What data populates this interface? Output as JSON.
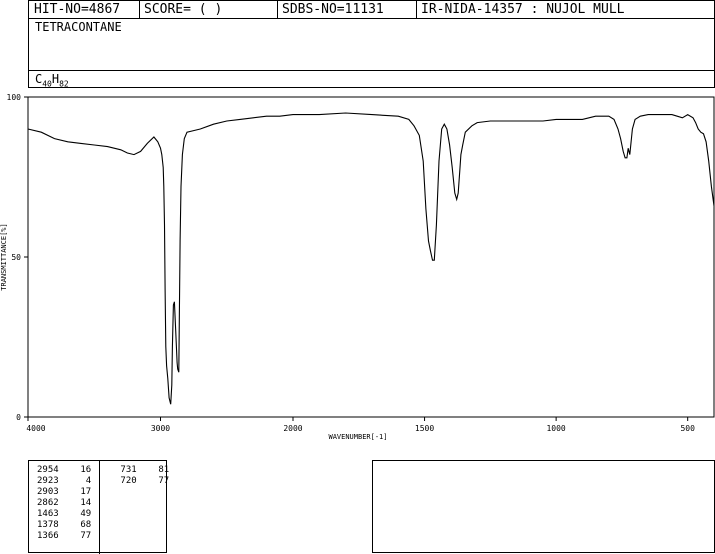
{
  "header": {
    "hit_no": "HIT-NO=4867",
    "score": "SCORE=  (   )",
    "sdbs_no": "SDBS-NO=11131",
    "ir_id": "IR-NIDA-14357 : NUJOL MULL"
  },
  "compound": {
    "name": "TETRACONTANE",
    "formula_c": "C",
    "formula_c_count": "40",
    "formula_h": "H",
    "formula_h_count": "82"
  },
  "chart_data": {
    "type": "line",
    "xlabel": "WAVENUMBER[-1]",
    "ylabel": "TRANSMITTANCE[%]",
    "xlim": [
      4000,
      400
    ],
    "ylim": [
      0,
      100
    ],
    "x_ticks": [
      "4000",
      "3000",
      "2000",
      "1500",
      "1000",
      "500"
    ],
    "x_tick_values": [
      4000,
      3000,
      2000,
      1500,
      1000,
      500
    ],
    "y_ticks": [
      "0",
      "50",
      "100"
    ],
    "y_tick_values": [
      0,
      50,
      100
    ],
    "series": [
      {
        "x": [
          4000,
          3900,
          3800,
          3700,
          3600,
          3500,
          3400,
          3300,
          3250,
          3200,
          3150,
          3100,
          3050,
          3020,
          3000,
          2990,
          2980,
          2975,
          2970,
          2965,
          2960,
          2954,
          2945,
          2935,
          2923,
          2915,
          2910,
          2903,
          2895,
          2885,
          2875,
          2870,
          2862,
          2858,
          2852,
          2845,
          2835,
          2820,
          2800,
          2750,
          2700,
          2600,
          2500,
          2400,
          2300,
          2200,
          2100,
          2000,
          1900,
          1800,
          1700,
          1600,
          1560,
          1540,
          1520,
          1505,
          1495,
          1485,
          1478,
          1470,
          1463,
          1455,
          1445,
          1435,
          1425,
          1415,
          1405,
          1395,
          1385,
          1378,
          1372,
          1366,
          1362,
          1355,
          1345,
          1320,
          1300,
          1250,
          1200,
          1150,
          1100,
          1050,
          1000,
          950,
          900,
          850,
          800,
          780,
          765,
          755,
          745,
          738,
          731,
          726,
          720,
          715,
          710,
          700,
          680,
          650,
          600,
          560,
          540,
          520,
          500,
          480,
          470,
          460,
          450,
          440,
          430,
          420,
          410,
          400
        ],
        "y": [
          90,
          89,
          87,
          86,
          85.5,
          85,
          84.5,
          83.5,
          82.5,
          82,
          83,
          85.5,
          87.5,
          86,
          84,
          82,
          78,
          72,
          60,
          40,
          22,
          16,
          12,
          6,
          4,
          10,
          22,
          35,
          36,
          27,
          17,
          15,
          14,
          30,
          55,
          72,
          82,
          87,
          89,
          89.5,
          90,
          91.5,
          92.5,
          93,
          93.5,
          94,
          94,
          94.5,
          94.5,
          95,
          94.5,
          94,
          93,
          91,
          88,
          80,
          65,
          55,
          52,
          49,
          49,
          60,
          80,
          90,
          91.5,
          90,
          85,
          78,
          70,
          68,
          70,
          77,
          82,
          85,
          89,
          91,
          92,
          92.5,
          92.5,
          92.5,
          92.5,
          92.5,
          93,
          93,
          93,
          94,
          94,
          93,
          90,
          87,
          83,
          81,
          81,
          84,
          82,
          86,
          90,
          93,
          94,
          94.5,
          94.5,
          94.5,
          94,
          93.5,
          94.5,
          93.5,
          92,
          90,
          89,
          88.5,
          86,
          80,
          72,
          66
        ]
      }
    ]
  },
  "peaks": {
    "col1": [
      [
        "2954",
        "16"
      ],
      [
        "2923",
        "4"
      ],
      [
        "2903",
        "17"
      ],
      [
        "2862",
        "14"
      ],
      [
        "1463",
        "49"
      ],
      [
        "1378",
        "68"
      ],
      [
        "1366",
        "77"
      ]
    ],
    "col2": [
      [
        "731",
        "81"
      ],
      [
        "720",
        "77"
      ]
    ]
  }
}
